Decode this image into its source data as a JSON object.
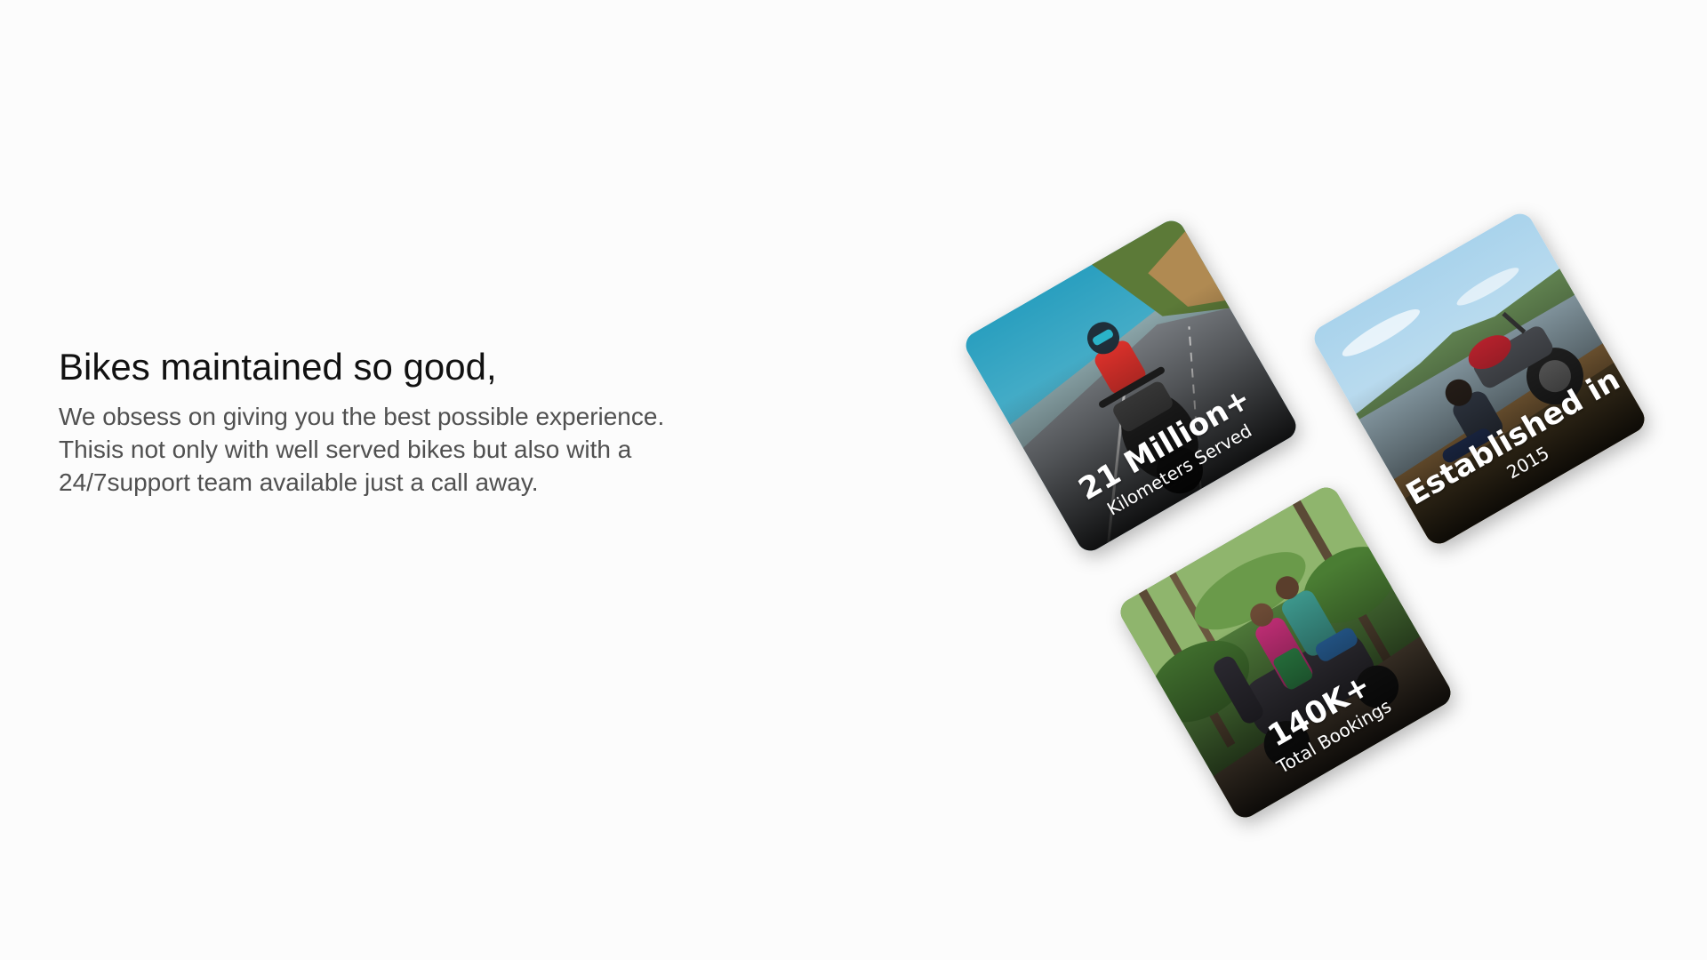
{
  "intro": {
    "heading": "Bikes maintained so good,",
    "body": "We obsess on giving you the best possible experience. Thisis not only with well served bikes but also with a 24/7support team available just a call away."
  },
  "stats": {
    "kilometers": {
      "value": "21 Million+",
      "label": "Kilometers Served"
    },
    "established": {
      "value": "Established in",
      "label": "2015"
    },
    "bookings": {
      "value": "140K+",
      "label": "Total Bookings"
    }
  }
}
